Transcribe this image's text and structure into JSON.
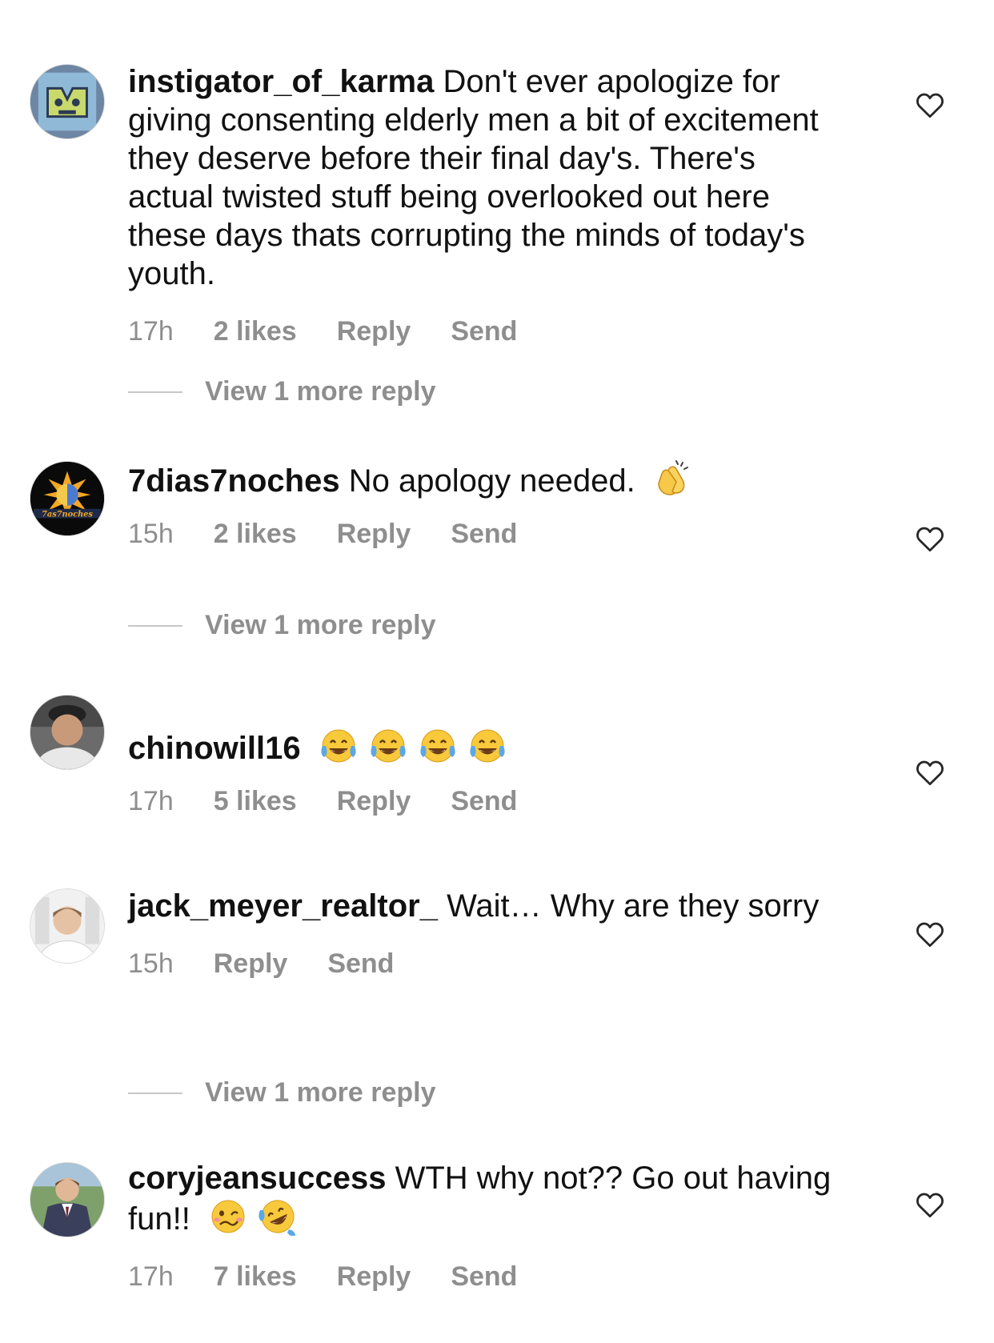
{
  "comments": [
    {
      "username": "instigator_of_karma",
      "text": "Don't ever apologize for giving consenting elderly men a bit of excitement they deserve before their final day's. There's actual twisted stuff being overlooked out here these days thats corrupting the minds of today's youth.",
      "time": "17h",
      "likes": "2 likes",
      "reply": "Reply",
      "send": "Send",
      "view_more": "View 1 more reply"
    },
    {
      "username": "7dias7noches",
      "text": "No apology needed.",
      "emoji": [
        "clapping-hands"
      ],
      "time": "15h",
      "likes": "2 likes",
      "reply": "Reply",
      "send": "Send",
      "view_more": "View 1 more reply"
    },
    {
      "username": "chinowill16",
      "text": "",
      "emoji": [
        "tears-of-joy",
        "tears-of-joy",
        "tears-of-joy",
        "tears-of-joy"
      ],
      "time": "17h",
      "likes": "5 likes",
      "reply": "Reply",
      "send": "Send"
    },
    {
      "username": "jack_meyer_realtor_",
      "text": "Wait… Why are they sorry",
      "time": "15h",
      "reply": "Reply",
      "send": "Send",
      "view_more": "View 1 more reply"
    },
    {
      "username": "coryjeansuccess",
      "text": "WTH why not?? Go out having fun!!",
      "emoji": [
        "woozy-face",
        "rolling-on-floor-laughing"
      ],
      "time": "17h",
      "likes": "7 likes",
      "reply": "Reply",
      "send": "Send"
    }
  ],
  "colors": {
    "text": "#111111",
    "muted": "#8e8e8e",
    "divider": "#c7c7c7"
  },
  "icons": {
    "like": "heart-outline-icon"
  }
}
